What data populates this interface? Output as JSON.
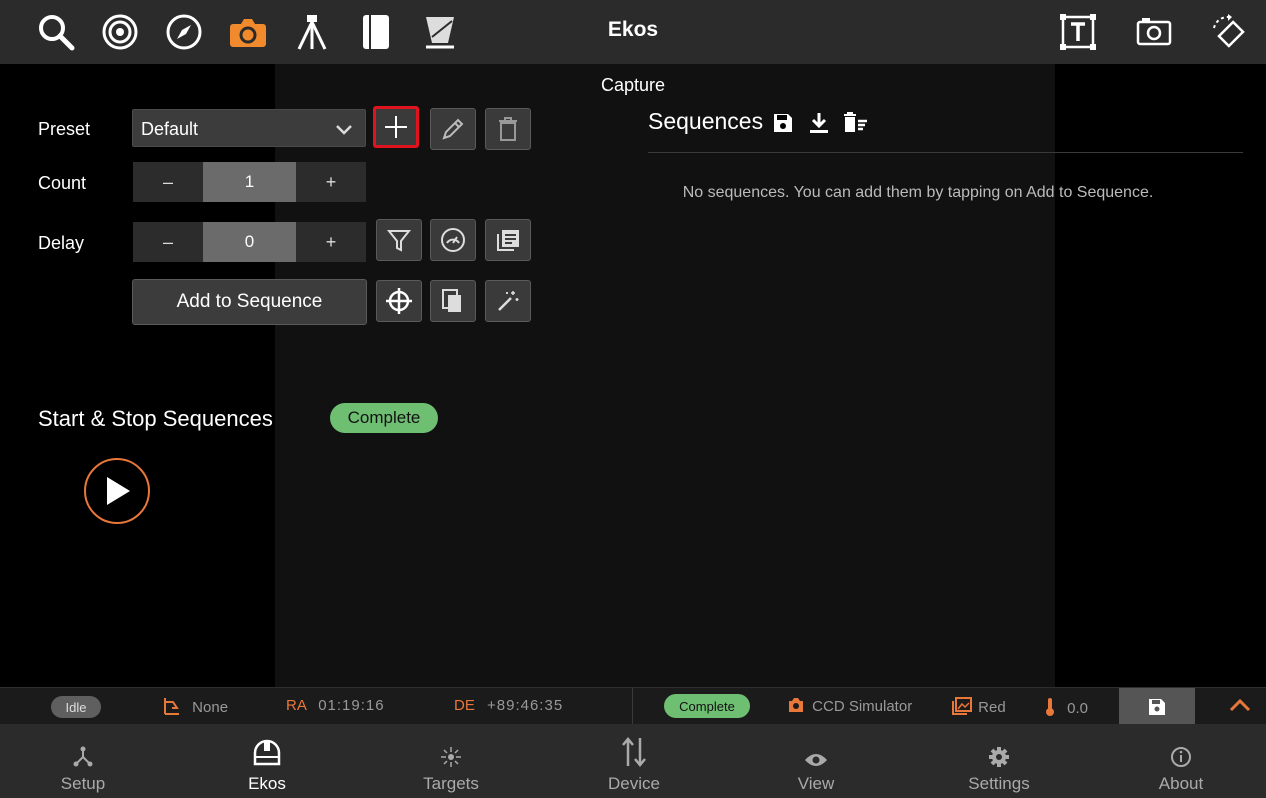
{
  "app": {
    "title": "Ekos"
  },
  "top_icons": [
    "search-icon",
    "target-icon",
    "compass-icon",
    "camera-icon",
    "tripod-icon",
    "notebook-icon",
    "flat-field-icon"
  ],
  "top_right_icons": [
    "text-box-icon",
    "screenshot-icon",
    "rotate-device-icon"
  ],
  "colors": {
    "accent": "#e8773a",
    "badge_green": "#6fbf73",
    "highlight_red": "#e0141e"
  },
  "capture": {
    "title": "Capture",
    "preset": {
      "label": "Preset",
      "value": "Default"
    },
    "count": {
      "label": "Count",
      "minus": "–",
      "value": "1",
      "plus": "+"
    },
    "delay": {
      "label": "Delay",
      "minus": "–",
      "value": "0",
      "plus": "+"
    },
    "add_to_sequence": "Add to Sequence",
    "start_stop": {
      "title": "Start & Stop Sequences",
      "status": "Complete"
    }
  },
  "sequences": {
    "title": "Sequences",
    "empty_text": "No sequences. You can add them by tapping on Add to Sequence."
  },
  "statusbar": {
    "state": "Idle",
    "mount": "None",
    "ra_label": "RA",
    "ra_value": "01:19:16",
    "de_label": "DE",
    "de_value": "+89:46:35",
    "capture_status": "Complete",
    "camera": "CCD Simulator",
    "filter": "Red",
    "temperature": "0.0"
  },
  "bottom_nav": [
    {
      "label": "Setup",
      "icon": "setup-icon"
    },
    {
      "label": "Ekos",
      "icon": "ekos-dome-icon"
    },
    {
      "label": "Targets",
      "icon": "targets-icon"
    },
    {
      "label": "Device",
      "icon": "device-icon"
    },
    {
      "label": "View",
      "icon": "view-icon"
    },
    {
      "label": "Settings",
      "icon": "settings-icon"
    },
    {
      "label": "About",
      "icon": "about-icon"
    }
  ]
}
